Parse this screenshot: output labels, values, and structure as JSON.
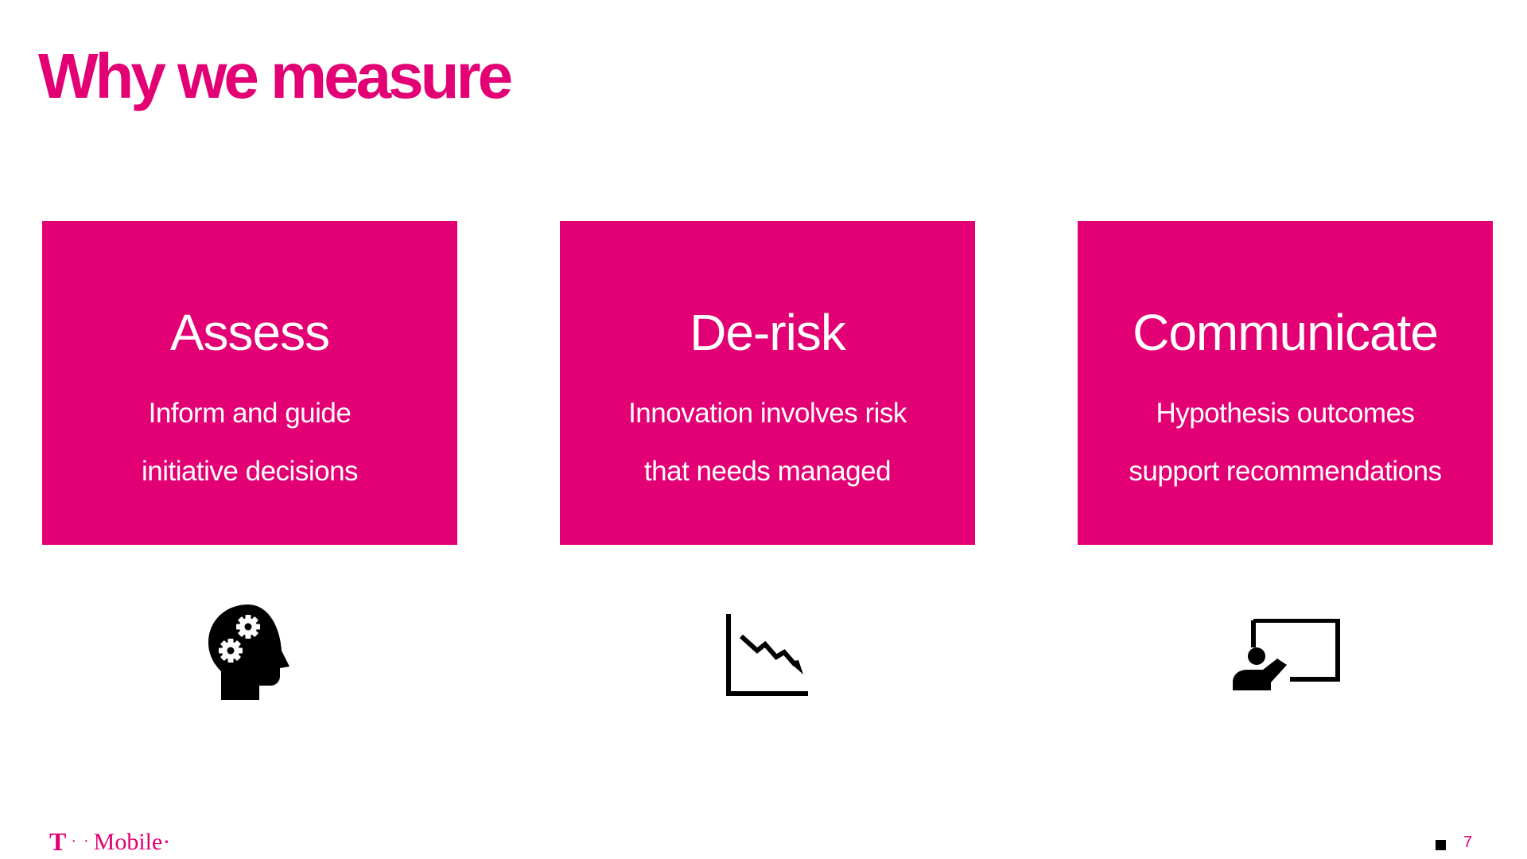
{
  "title": "Why we measure",
  "colors": {
    "brand_magenta": "#E20074",
    "card_text": "#FFFFFF",
    "icon": "#000000",
    "background": "#FFFFFF"
  },
  "cards": [
    {
      "heading": "Assess",
      "lines": [
        "Inform and guide",
        "initiative decisions"
      ],
      "icon": "head-gears-icon"
    },
    {
      "heading": "De-risk",
      "lines": [
        "Innovation involves risk",
        "that needs managed"
      ],
      "icon": "declining-chart-icon"
    },
    {
      "heading": "Communicate",
      "lines": [
        "Hypothesis outcomes",
        "support recommendations"
      ],
      "icon": "presenter-board-icon"
    }
  ],
  "footer": {
    "logo_t": "T",
    "logo_dots": "· ·",
    "logo_word": "Mobile·",
    "page_number": "7"
  }
}
